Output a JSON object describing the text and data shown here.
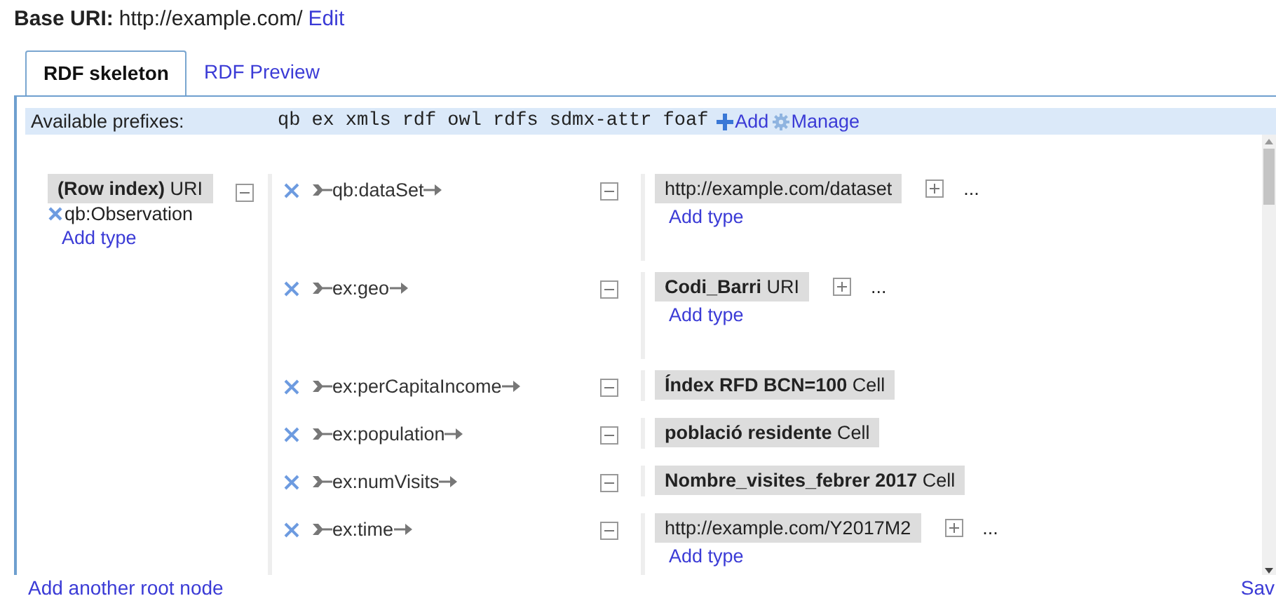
{
  "base_uri": {
    "label": "Base URI:",
    "value": "http://example.com/",
    "edit": "Edit"
  },
  "tabs": [
    {
      "label": "RDF skeleton",
      "selected": true
    },
    {
      "label": "RDF Preview",
      "selected": false
    }
  ],
  "prefixes": {
    "label": "Available prefixes:",
    "items": [
      "qb",
      "ex",
      "xmls",
      "rdf",
      "owl",
      "rdfs",
      "sdmx-attr",
      "foaf"
    ],
    "add": "Add",
    "manage": "Manage"
  },
  "root": {
    "name": "(Row index)",
    "node_type": "URI",
    "types": [
      "qb:Observation"
    ],
    "add_type": "Add type",
    "properties": [
      {
        "name": "qb:dataSet",
        "target": {
          "name": "http://example.com/dataset",
          "kind": "constant",
          "more": "...",
          "add_type": "Add type"
        }
      },
      {
        "name": "ex:geo",
        "target": {
          "name": "Codi_Barri",
          "kind": "column",
          "node_type": "URI",
          "more": "...",
          "add_type": "Add type"
        }
      },
      {
        "name": "ex:perCapitaIncome",
        "target": {
          "name": "Índex RFD BCN=100",
          "kind": "column",
          "node_type": "Cell"
        }
      },
      {
        "name": "ex:population",
        "target": {
          "name": "població residente",
          "kind": "column",
          "node_type": "Cell"
        }
      },
      {
        "name": "ex:numVisits",
        "target": {
          "name": "Nombre_visites_febrer 2017",
          "kind": "column",
          "node_type": "Cell"
        }
      },
      {
        "name": "ex:time",
        "target": {
          "name": "http://example.com/Y2017M2",
          "kind": "constant",
          "more": "...",
          "add_type": "Add type"
        }
      }
    ]
  },
  "footer": {
    "add_root": "Add another root node",
    "save": "Sav"
  }
}
